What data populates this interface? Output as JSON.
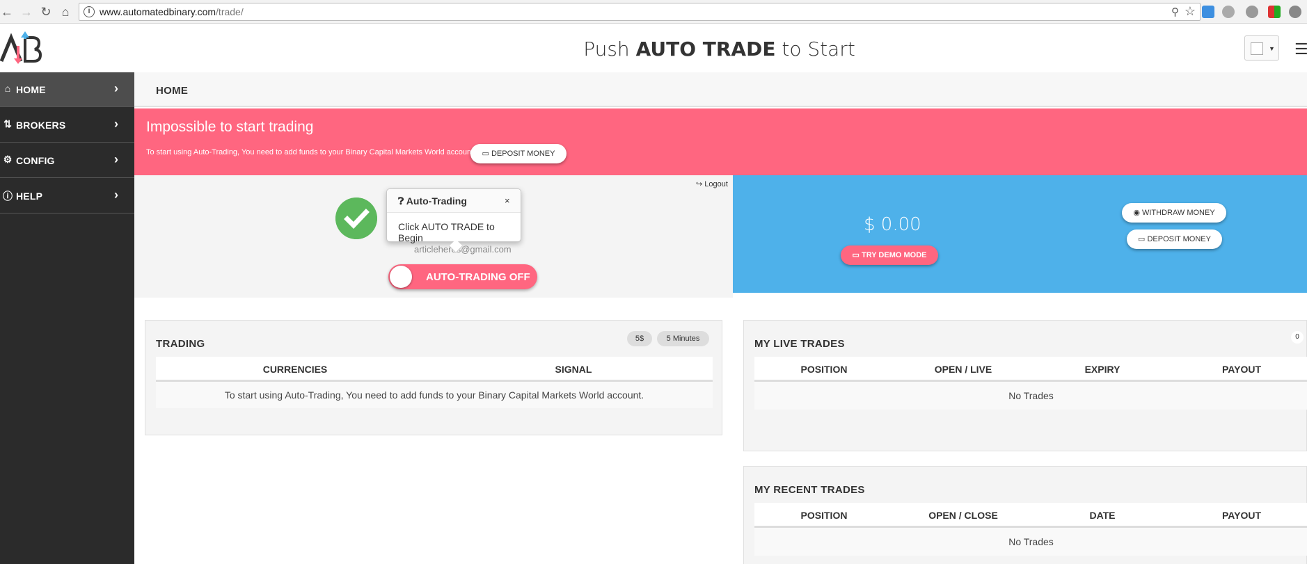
{
  "browser": {
    "url_domain": "www.automatedbinary.com",
    "url_path": "/trade/"
  },
  "header": {
    "headline_pre": "Push",
    "headline_bold": "AUTO TRADE",
    "headline_post": "to Start"
  },
  "sidebar": {
    "items": [
      {
        "label": "HOME",
        "icon": "home-icon"
      },
      {
        "label": "BROKERS",
        "icon": "sort-arrows-icon"
      },
      {
        "label": "CONFIG",
        "icon": "gear-icon"
      },
      {
        "label": "HELP",
        "icon": "info-icon"
      }
    ]
  },
  "breadcrumb": "HOME",
  "alert": {
    "title": "Impossible to start trading",
    "message": "To start using Auto-Trading, You need to add funds to your Binary Capital Markets World account.",
    "deposit_label": "DEPOSIT MONEY"
  },
  "status": {
    "email": "articleheros@gmail.com",
    "logout_label": "Logout",
    "toggle_label": "AUTO-TRADING OFF"
  },
  "popover": {
    "title": "Auto-Trading",
    "close": "×",
    "body": "Click AUTO TRADE to Begin"
  },
  "balance": {
    "amount": "$ 0.00",
    "demo_label": "TRY DEMO MODE",
    "withdraw_label": "WITHDRAW MONEY",
    "deposit_label": "DEPOSIT MONEY"
  },
  "trading": {
    "title": "TRADING",
    "amount_chip": "5$",
    "expiry_chip": "5 Minutes",
    "columns": [
      "CURRENCIES",
      "SIGNAL"
    ],
    "empty_message": "To start using Auto-Trading, You need to add funds to your Binary Capital Markets World account."
  },
  "live_trades": {
    "title": "MY LIVE TRADES",
    "count": "0",
    "columns": [
      "POSITION",
      "OPEN / LIVE",
      "EXPIRY",
      "PAYOUT"
    ],
    "empty_message": "No Trades"
  },
  "recent_trades": {
    "title": "MY RECENT TRADES",
    "columns": [
      "POSITION",
      "OPEN / CLOSE",
      "DATE",
      "PAYOUT"
    ],
    "empty_message": "No Trades"
  },
  "colors": {
    "alert": "#ff6680",
    "balance_panel": "#4eb1ea",
    "sidebar": "#2b2b2b",
    "success": "#5cb85c"
  }
}
